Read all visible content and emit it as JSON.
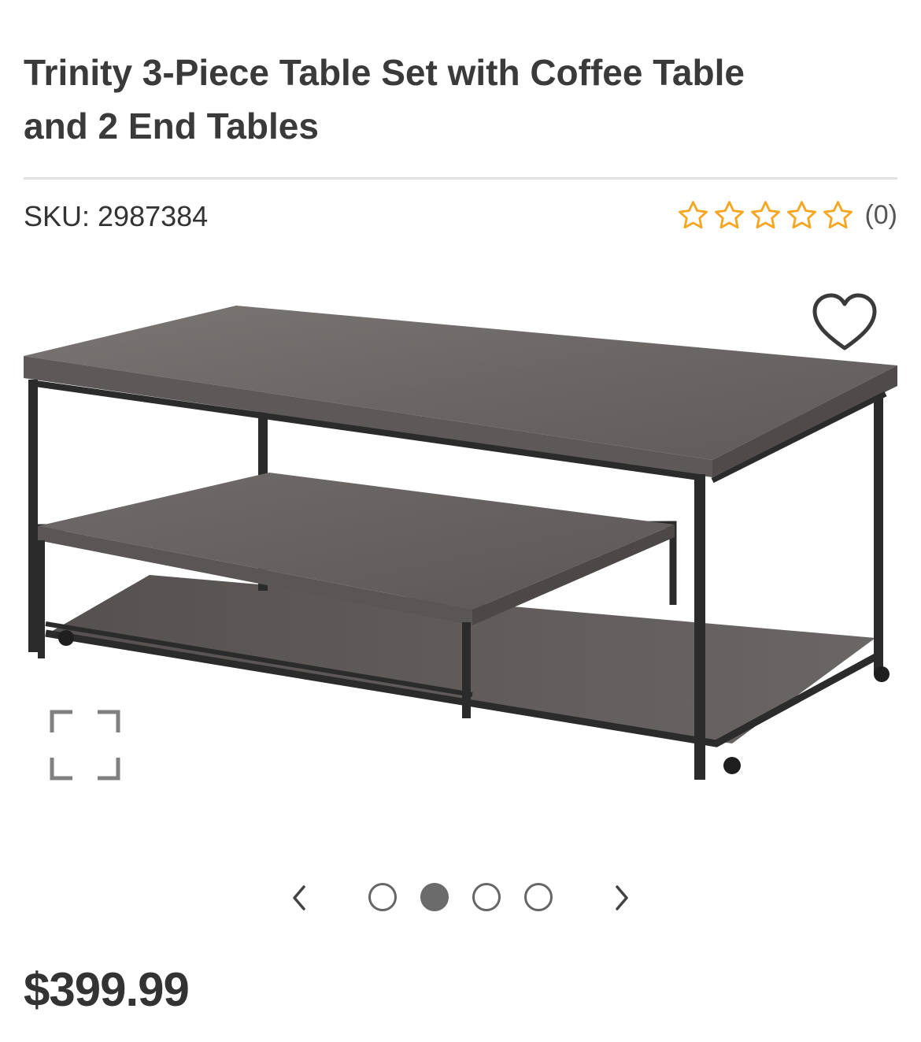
{
  "product": {
    "title_line1": "Trinity 3-Piece Table Set with Coffee Table",
    "title_line2": "and 2 End Tables",
    "sku": "SKU: 2987384",
    "rating": 0,
    "rating_max": 5,
    "review_count": "(0)",
    "price": "$399.99"
  },
  "gallery": {
    "image_count": 4,
    "active_index": 1,
    "icons": {
      "favorite": "heart-icon",
      "expand": "expand-icon",
      "prev": "chevron-left-icon",
      "next": "chevron-right-icon"
    }
  },
  "colors": {
    "star": "#f5a623",
    "text": "#333333",
    "wood": "#6e6b6a",
    "frame": "#2a2a2a"
  }
}
